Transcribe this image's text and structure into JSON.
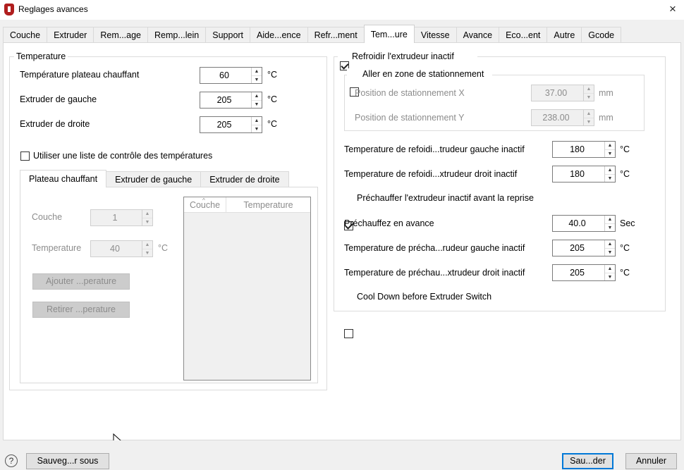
{
  "window": {
    "title": "Reglages avances",
    "close_icon": "×"
  },
  "tabs": [
    {
      "label": "Couche"
    },
    {
      "label": "Extruder"
    },
    {
      "label": "Rem...age"
    },
    {
      "label": "Remp...lein"
    },
    {
      "label": "Support"
    },
    {
      "label": "Aide...ence"
    },
    {
      "label": "Refr...ment"
    },
    {
      "label": "Tem...ure",
      "active": true
    },
    {
      "label": "Vitesse"
    },
    {
      "label": "Avance"
    },
    {
      "label": "Eco...ent"
    },
    {
      "label": "Autre"
    },
    {
      "label": "Gcode"
    }
  ],
  "left": {
    "group_title": "Temperature",
    "rows": [
      {
        "label": "Température plateau chauffant",
        "value": "60",
        "unit": "°C"
      },
      {
        "label": "Extruder de gauche",
        "value": "205",
        "unit": "°C"
      },
      {
        "label": "Extruder de droite",
        "value": "205",
        "unit": "°C"
      }
    ],
    "use_list_checkbox": {
      "label": "Utiliser une liste de contrôle des températures",
      "checked": false
    },
    "subtabs": [
      {
        "label": "Plateau chauffant",
        "active": true
      },
      {
        "label": "Extruder de gauche"
      },
      {
        "label": "Extruder de droite"
      }
    ],
    "couche_label": "Couche",
    "couche_value": "1",
    "temp_label": "Temperature",
    "temp_value": "40",
    "temp_unit": "°C",
    "add_button": "Ajouter ...perature",
    "remove_button": "Retirer ...perature",
    "table_headers": [
      "Couche",
      "Temperature"
    ]
  },
  "right": {
    "cool_inactive": {
      "label": "Refroidir l'extrudeur inactif",
      "checked": true
    },
    "park": {
      "label": "Aller en zone de stationnement",
      "checked": false
    },
    "park_x": {
      "label": "Position de stationnement X",
      "value": "37.00",
      "unit": "mm"
    },
    "park_y": {
      "label": "Position de stationnement Y",
      "value": "238.00",
      "unit": "mm"
    },
    "cool_left": {
      "label": "Temperature de refoidi...trudeur gauche inactif",
      "value": "180",
      "unit": "°C"
    },
    "cool_right": {
      "label": "Temperature de refoidi...xtrudeur droit inactif",
      "value": "180",
      "unit": "°C"
    },
    "preheat": {
      "label": "Préchauffer l'extrudeur inactif avant la reprise",
      "checked": true
    },
    "preheat_adv": {
      "label": "Préchauffez en avance",
      "value": "40.0",
      "unit": "Sec"
    },
    "preheat_left": {
      "label": "Temperature de précha...rudeur gauche inactif",
      "value": "205",
      "unit": "°C"
    },
    "preheat_right": {
      "label": "Temperature de préchau...xtrudeur droit inactif",
      "value": "205",
      "unit": "°C"
    },
    "cooldown_switch": {
      "label": "Cool Down before Extruder Switch",
      "checked": false
    }
  },
  "bottom": {
    "help_icon": "?",
    "save_as": "Sauveg...r sous",
    "save": "Sau...der",
    "cancel": "Annuler"
  }
}
